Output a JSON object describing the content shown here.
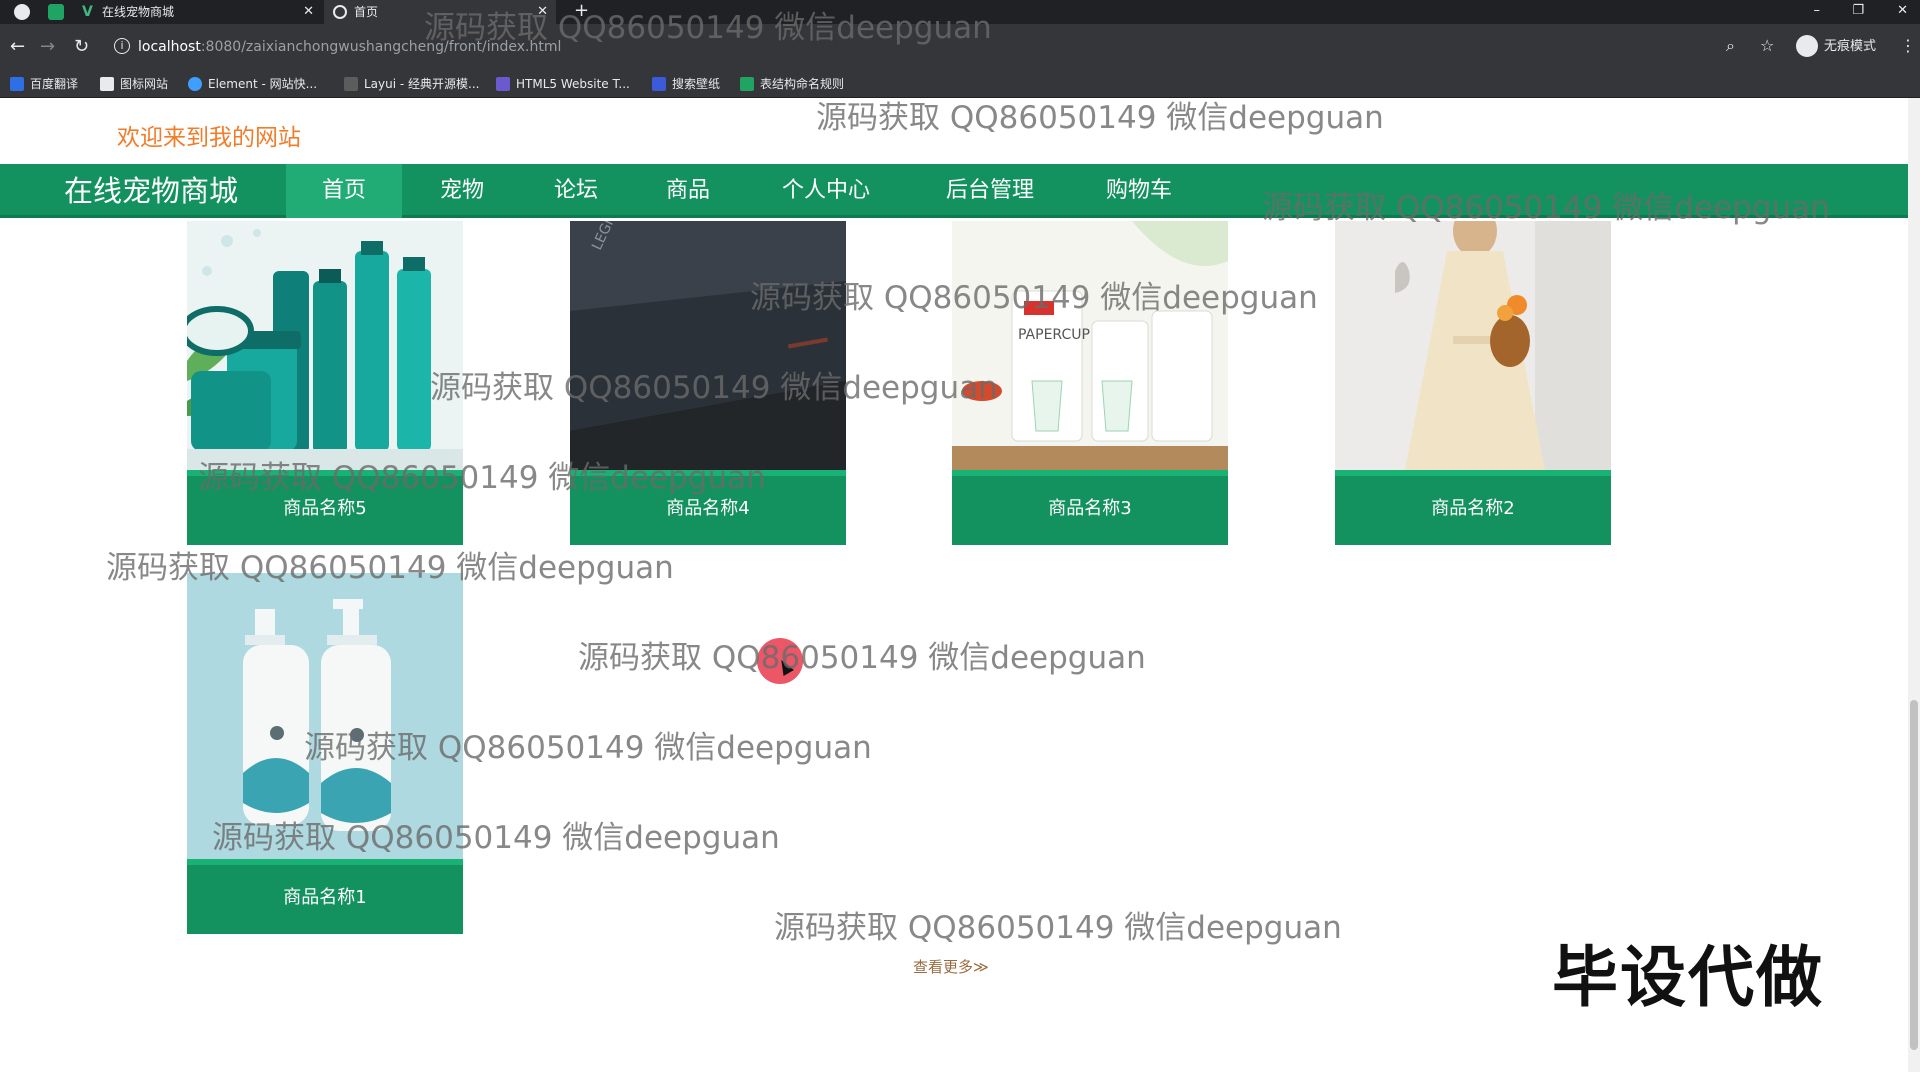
{
  "browser": {
    "tabs": [
      {
        "label": "在线宠物商城",
        "active": false
      },
      {
        "label": "首页",
        "active": true
      }
    ],
    "url_host": "localhost",
    "url_path": ":8080/zaixianchongwushangcheng/front/index.html",
    "profile_label": "无痕模式",
    "bookmarks": [
      "百度翻译",
      "图标网站",
      "Element - 网站快...",
      "Layui - 经典开源模...",
      "HTML5 Website T...",
      "搜索壁纸",
      "表结构命名规则"
    ]
  },
  "site": {
    "welcome": "欢迎来到我的网站",
    "brand": "在线宠物商城",
    "nav": [
      "首页",
      "宠物",
      "论坛",
      "商品",
      "个人中心",
      "后台管理",
      "购物车"
    ],
    "active_nav": "首页"
  },
  "products": [
    {
      "name": "商品名称5",
      "image": "skincare-products"
    },
    {
      "name": "商品名称4",
      "image": "laptop"
    },
    {
      "name": "商品名称3",
      "image": "paper-cups"
    },
    {
      "name": "商品名称2",
      "image": "dress"
    },
    {
      "name": "商品名称1",
      "image": "shampoo-bottles"
    }
  ],
  "more_link": "查看更多≫",
  "watermark_text": "源码获取 QQ86050149 微信deepguan",
  "promo_text": "毕设代做",
  "colors": {
    "primary_green": "#13925f",
    "active_green": "#21ab75",
    "welcome_orange": "#f07d2b"
  }
}
